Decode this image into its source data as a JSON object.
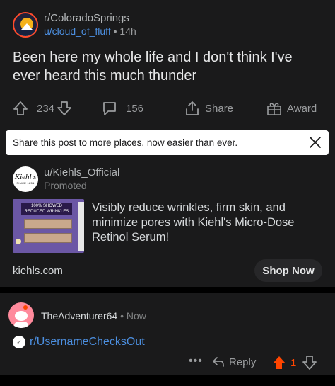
{
  "post": {
    "subreddit": "r/ColoradoSprings",
    "author": "u/cloud_of_fluff",
    "separator": "•",
    "age": "14h",
    "title": "Been here my whole life and I don't think I've ever heard this much thunder",
    "actions": {
      "votes": "234",
      "comments": "156",
      "share_label": "Share",
      "award_label": "Award"
    }
  },
  "toast": {
    "text": "Share this post to more places, now easier than ever."
  },
  "ad": {
    "logo_text": "Kiehl's",
    "logo_subtext": "SINCE 1851",
    "image_caption": "100% SHOWED REDUCED WRINKLES",
    "user": "u/Kiehls_Official",
    "promoted_label": "Promoted",
    "copy": "Visibly reduce wrinkles, firm skin, and minimize pores with Kiehl's Micro-Dose Retinol Serum!",
    "domain": "kiehls.com",
    "cta_label": "Shop Now"
  },
  "comment": {
    "author": "TheAdventurer64",
    "separator": "•",
    "time": "Now",
    "link_text": "r/UsernameChecksOut",
    "more_label": "•••",
    "reply_label": "Reply",
    "score": "1",
    "upvote_color": "#ff4500"
  },
  "icons": [
    "subreddit-avatar-icon",
    "upvote-icon",
    "downvote-icon",
    "comment-icon",
    "share-icon",
    "award-icon",
    "close-icon",
    "kiehls-logo-icon",
    "snoo-avatar-icon",
    "subreddit-small-icon",
    "reply-icon",
    "more-icon"
  ]
}
